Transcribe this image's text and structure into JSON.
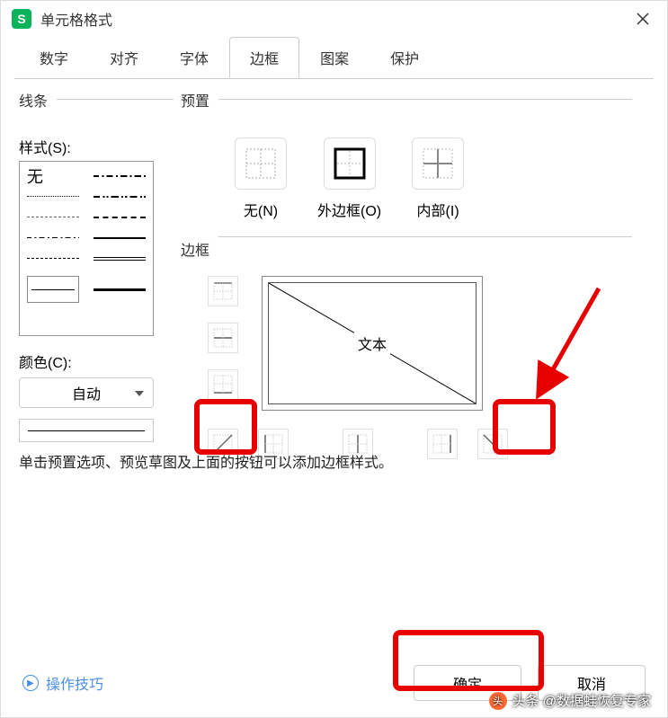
{
  "titlebar": {
    "title": "单元格格式"
  },
  "tabs": [
    "数字",
    "对齐",
    "字体",
    "边框",
    "图案",
    "保护"
  ],
  "activeTab": 3,
  "leftPanel": {
    "lineSection": "线条",
    "styleLabel": "样式(S):",
    "noneLabel": "无",
    "colorLabel": "颜色(C):",
    "colorValue": "自动"
  },
  "rightPanel": {
    "presetSection": "预置",
    "presets": [
      {
        "label": "无(N)"
      },
      {
        "label": "外边框(O)"
      },
      {
        "label": "内部(I)"
      }
    ],
    "borderSection": "边框",
    "previewText": "文本"
  },
  "hint": "单击预置选项、预览草图及上面的按钮可以添加边框样式。",
  "footer": {
    "tips": "操作技巧",
    "ok": "确定",
    "cancel": "取消"
  },
  "watermark": "头条 @数据蛙恢复专家"
}
